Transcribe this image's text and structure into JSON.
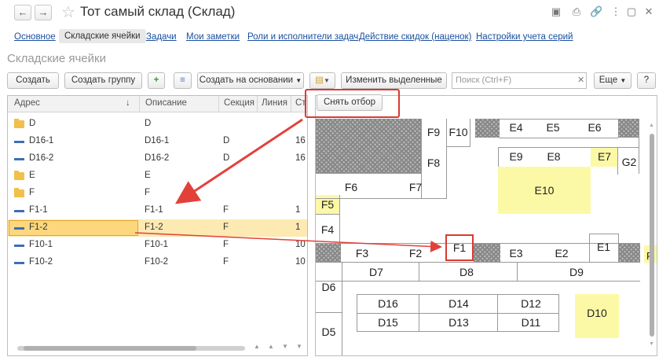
{
  "window": {
    "title": "Тот самый склад (Склад)"
  },
  "tabs": [
    "Основное",
    "Складские ячейки",
    "Задачи",
    "Мои заметки",
    "Роли и исполнители задач",
    "Действие скидок (наценок)",
    "Настройки учета серий"
  ],
  "form_title": "Складские ячейки",
  "toolbar": {
    "create": "Создать",
    "create_group": "Создать группу",
    "create_based": "Создать на основании",
    "change_selected": "Изменить выделенные",
    "search_placeholder": "Поиск (Ctrl+F)",
    "more": "Еще",
    "help": "?"
  },
  "filter_button": "Снять отбор",
  "columns": {
    "address": "Адрес",
    "sort": "↓",
    "description": "Описание",
    "section": "Секция",
    "line": "Линия",
    "rack": "Ст"
  },
  "rows": [
    {
      "type": "folder",
      "address": "D",
      "description": "D",
      "section": "",
      "rack": ""
    },
    {
      "type": "item",
      "address": "D16-1",
      "description": "D16-1",
      "section": "D",
      "rack": "16"
    },
    {
      "type": "item",
      "address": "D16-2",
      "description": "D16-2",
      "section": "D",
      "rack": "16"
    },
    {
      "type": "folder",
      "address": "E",
      "description": "E",
      "section": "",
      "rack": ""
    },
    {
      "type": "folder",
      "address": "F",
      "description": "F",
      "section": "",
      "rack": ""
    },
    {
      "type": "item",
      "address": "F1-1",
      "description": "F1-1",
      "section": "F",
      "rack": "1"
    },
    {
      "type": "item",
      "address": "F1-2",
      "description": "F1-2",
      "section": "F",
      "rack": "1"
    },
    {
      "type": "item",
      "address": "F10-1",
      "description": "F10-1",
      "section": "F",
      "rack": "10"
    },
    {
      "type": "item",
      "address": "F10-2",
      "description": "F10-2",
      "section": "F",
      "rack": "10"
    }
  ],
  "map_labels": {
    "f9": "F9",
    "f10": "F10",
    "e4": "E4",
    "e5": "E5",
    "e6": "E6",
    "f8": "F8",
    "e9": "E9",
    "e8": "E8",
    "e7": "E7",
    "g2": "G2",
    "f6": "F6",
    "f7": "F7",
    "e10": "E10",
    "f5": "F5",
    "f4": "F4",
    "f3": "F3",
    "f2": "F2",
    "f1": "F1",
    "e3": "E3",
    "e2": "E2",
    "e1": "E1",
    "f_edge": "F",
    "d7": "D7",
    "d8": "D8",
    "d9": "D9",
    "d6": "D6",
    "d16": "D16",
    "d14": "D14",
    "d12": "D12",
    "d10": "D10",
    "d15": "D15",
    "d13": "D13",
    "d11": "D11",
    "d5": "D5"
  },
  "colors": {
    "highlight": "#fcf9a6",
    "selection": "#fde9b2",
    "arrow": "#e2413a",
    "link": "#1a4fa0"
  }
}
